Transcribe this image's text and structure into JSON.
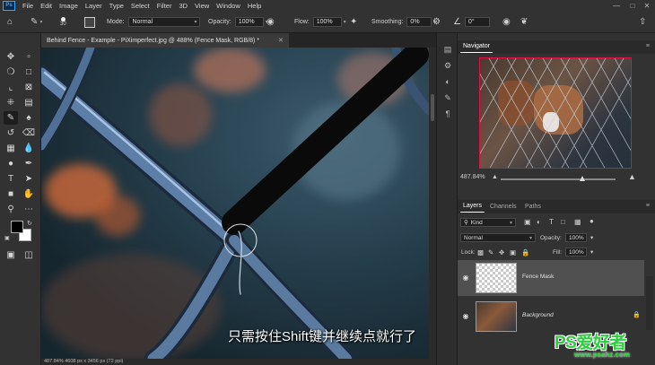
{
  "app": {
    "logo": "Ps"
  },
  "menu": [
    "File",
    "Edit",
    "Image",
    "Layer",
    "Type",
    "Select",
    "Filter",
    "3D",
    "View",
    "Window",
    "Help"
  ],
  "options": {
    "brush_size": "30",
    "mode_label": "Mode:",
    "mode_value": "Normal",
    "opacity_label": "Opacity:",
    "opacity_value": "100%",
    "flow_label": "Flow:",
    "flow_value": "100%",
    "smoothing_label": "Smoothing:",
    "smoothing_value": "0%",
    "angle_value": "0°"
  },
  "document": {
    "tab_title": "Behind Fence - Example - PiXimperfect.jpg @ 488% (Fence Mask, RGB/8) *",
    "status": "487.84%   4608 px x 3456 px (72 ppi)",
    "subtitle": "只需按住Shift键并继续点就行了"
  },
  "navigator": {
    "tab": "Navigator",
    "zoom": "487.84%"
  },
  "layers_panel": {
    "tabs": [
      "Layers",
      "Channels",
      "Paths"
    ],
    "kind_label": "Kind",
    "blend_mode": "Normal",
    "opacity_label": "Opacity:",
    "opacity_value": "100%",
    "lock_label": "Lock:",
    "fill_label": "Fill:",
    "fill_value": "100%",
    "layers": [
      {
        "name": "Fence Mask",
        "selected": true
      },
      {
        "name": "Background",
        "selected": false,
        "locked": true
      }
    ]
  },
  "watermark": {
    "brand": "PS爱好者",
    "url": "www.psahz.com"
  },
  "colors": {
    "accent_blue": "#31a8ff",
    "bg": "#323232",
    "watermark_green": "#2ecc40"
  }
}
